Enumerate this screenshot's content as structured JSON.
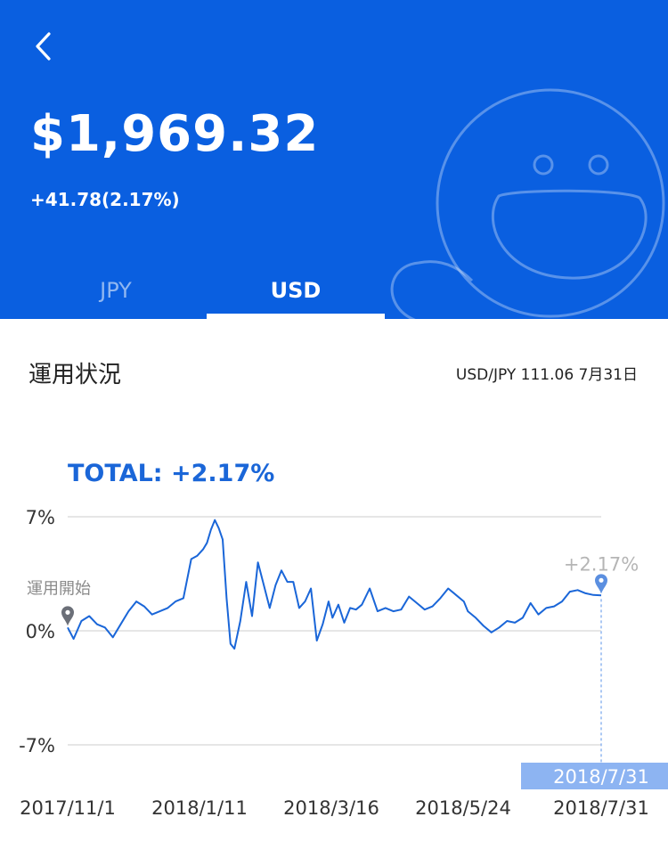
{
  "header": {
    "amount": "$1,969.32",
    "change": "+41.78(2.17%)",
    "back_icon": "chevron-left-icon",
    "mascot_icon": "smiley-mascot-icon",
    "tabs": [
      {
        "label": "JPY",
        "selected": false
      },
      {
        "label": "USD",
        "selected": true
      }
    ],
    "background_color": "#0a5fe0"
  },
  "section": {
    "title": "運用状況",
    "fx_rate": "USD/JPY 111.06 7月31日"
  },
  "chart_data": {
    "type": "line",
    "title": "TOTAL: +2.17%",
    "start_label": "運用開始",
    "end_value_label": "+2.17%",
    "current_date_badge": "2018/7/31",
    "y_tick_labels": [
      "7%",
      "0%",
      "-7%"
    ],
    "y_ticks": [
      7,
      0,
      -7
    ],
    "ylim": [
      -7,
      7
    ],
    "x_tick_labels": [
      "2017/11/1",
      "2018/1/11",
      "2018/3/16",
      "2018/5/24",
      "2018/7/31"
    ],
    "xlim": [
      "2017-11-01",
      "2018-07-31"
    ],
    "line_color": "#1a66d8",
    "series": [
      {
        "x": [
          "2017-11-01",
          "2017-11-04",
          "2017-11-08",
          "2017-11-12",
          "2017-11-16",
          "2017-11-20",
          "2017-11-24",
          "2017-11-28",
          "2017-12-02",
          "2017-12-06",
          "2017-12-10",
          "2017-12-14",
          "2017-12-18",
          "2017-12-22",
          "2017-12-26",
          "2017-12-30",
          "2018-01-03",
          "2018-01-06",
          "2018-01-09",
          "2018-01-11",
          "2018-01-13",
          "2018-01-15",
          "2018-01-17",
          "2018-01-19",
          "2018-01-21",
          "2018-01-23",
          "2018-01-25",
          "2018-01-28",
          "2018-01-31",
          "2018-02-03",
          "2018-02-06",
          "2018-02-09",
          "2018-02-12",
          "2018-02-15",
          "2018-02-18",
          "2018-02-21",
          "2018-02-24",
          "2018-02-27",
          "2018-03-02",
          "2018-03-05",
          "2018-03-08",
          "2018-03-11",
          "2018-03-14",
          "2018-03-16",
          "2018-03-19",
          "2018-03-22",
          "2018-03-25",
          "2018-03-28",
          "2018-03-31",
          "2018-04-04",
          "2018-04-08",
          "2018-04-12",
          "2018-04-16",
          "2018-04-20",
          "2018-04-24",
          "2018-04-28",
          "2018-05-02",
          "2018-05-06",
          "2018-05-10",
          "2018-05-14",
          "2018-05-18",
          "2018-05-22",
          "2018-05-24",
          "2018-05-28",
          "2018-06-01",
          "2018-06-05",
          "2018-06-09",
          "2018-06-13",
          "2018-06-17",
          "2018-06-21",
          "2018-06-25",
          "2018-06-29",
          "2018-07-03",
          "2018-07-07",
          "2018-07-11",
          "2018-07-15",
          "2018-07-19",
          "2018-07-23",
          "2018-07-27",
          "2018-07-31"
        ],
        "y": [
          0.2,
          -0.5,
          0.6,
          0.9,
          0.4,
          0.2,
          -0.4,
          0.4,
          1.2,
          1.8,
          1.5,
          1.0,
          1.2,
          1.4,
          1.8,
          2.0,
          4.4,
          4.6,
          5.0,
          5.4,
          6.2,
          6.8,
          6.3,
          5.6,
          2.0,
          -0.8,
          -1.1,
          0.6,
          3.0,
          0.9,
          4.2,
          2.8,
          1.4,
          2.8,
          3.7,
          3.0,
          3.0,
          1.4,
          1.8,
          2.6,
          -0.6,
          0.4,
          1.8,
          0.8,
          1.6,
          0.5,
          1.4,
          1.3,
          1.6,
          2.6,
          1.2,
          1.4,
          1.2,
          1.3,
          2.1,
          1.7,
          1.3,
          1.5,
          2.0,
          2.6,
          2.2,
          1.8,
          1.2,
          0.8,
          0.3,
          -0.1,
          0.2,
          0.6,
          0.5,
          0.8,
          1.7,
          1.0,
          1.4,
          1.5,
          1.8,
          2.4,
          2.5,
          2.3,
          2.2,
          2.17
        ]
      }
    ]
  }
}
